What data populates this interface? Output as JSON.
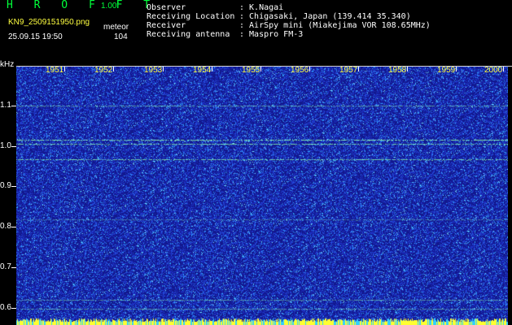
{
  "header": {
    "app_title": "H R O F F T",
    "version": "1.00f",
    "filename": "KN9_2509151950.png",
    "mode": "meteor",
    "timestamp": "25.09.15 19:50",
    "count": "104",
    "info": [
      {
        "label": "Observer",
        "value": ": K.Nagai"
      },
      {
        "label": "Receiving Location",
        "value": ": Chigasaki, Japan (139.414 35.340)"
      },
      {
        "label": "Receiver",
        "value": ": AirSpy mini (Miakejima VOR 108.65MHz)"
      },
      {
        "label": "Receiving antenna",
        "value": ": Maspro FM-3"
      }
    ]
  },
  "plot": {
    "y_unit": "kHz",
    "y_ticks": [
      "1.1",
      "1.0",
      "0.9",
      "0.8",
      "0.7",
      "0.6"
    ],
    "x_ticks": [
      "1951",
      "1952",
      "1953",
      "1954",
      "1955",
      "1956",
      "1957",
      "1958",
      "1959",
      "2000"
    ],
    "colors": {
      "background": "#12188e",
      "noise_low": "#2a3cd0",
      "noise_high": "#39c8ff",
      "signal_line": "#8cffb0",
      "baseline": "#ffff30"
    }
  }
}
